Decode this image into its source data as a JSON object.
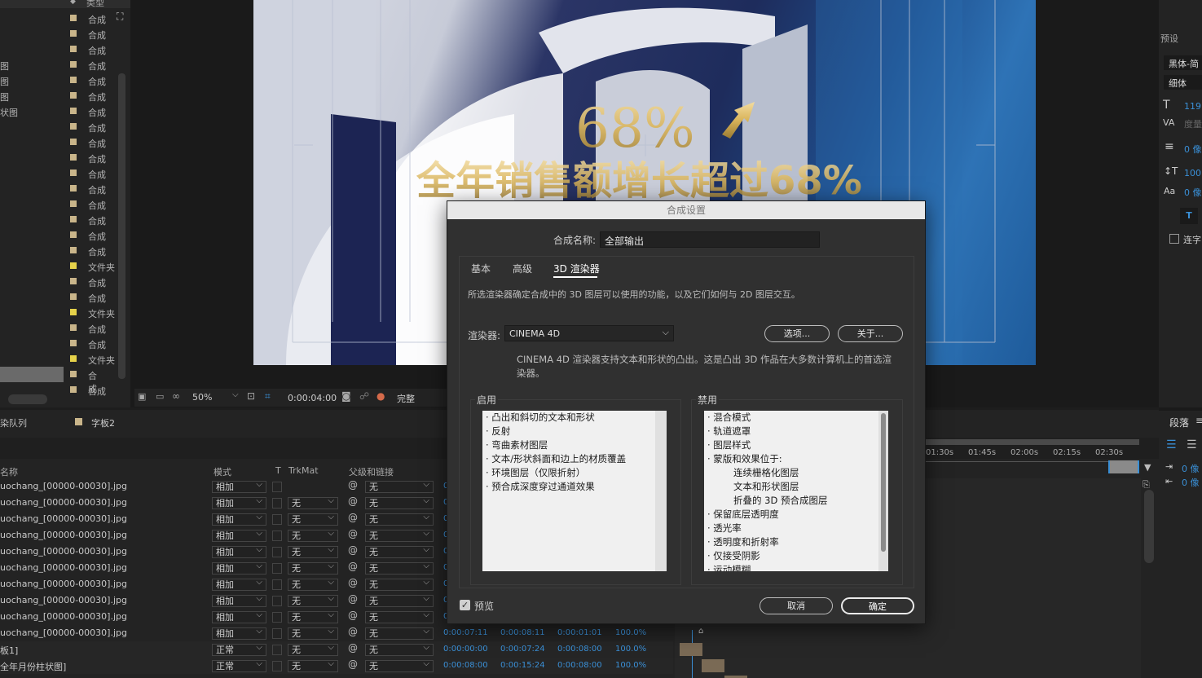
{
  "project_panel": {
    "type_header": "类型",
    "rows": [
      {
        "name": "",
        "type": "合成",
        "folder": false
      },
      {
        "name": "",
        "type": "合成",
        "folder": false
      },
      {
        "name": "",
        "type": "合成",
        "folder": false
      },
      {
        "name": "图",
        "type": "合成",
        "folder": false
      },
      {
        "name": "图",
        "type": "合成",
        "folder": false
      },
      {
        "name": "图",
        "type": "合成",
        "folder": false
      },
      {
        "name": "状图",
        "type": "合成",
        "folder": false
      },
      {
        "name": "",
        "type": "合成",
        "folder": false
      },
      {
        "name": "",
        "type": "合成",
        "folder": false
      },
      {
        "name": "",
        "type": "合成",
        "folder": false
      },
      {
        "name": "",
        "type": "合成",
        "folder": false
      },
      {
        "name": "",
        "type": "合成",
        "folder": false
      },
      {
        "name": "",
        "type": "合成",
        "folder": false
      },
      {
        "name": "",
        "type": "合成",
        "folder": false
      },
      {
        "name": "",
        "type": "合成",
        "folder": false
      },
      {
        "name": "",
        "type": "合成",
        "folder": false
      },
      {
        "name": "",
        "type": "文件夹",
        "folder": true
      },
      {
        "name": "",
        "type": "合成",
        "folder": false
      },
      {
        "name": "",
        "type": "合成",
        "folder": false
      },
      {
        "name": "",
        "type": "文件夹",
        "folder": true
      },
      {
        "name": "",
        "type": "合成",
        "folder": false
      },
      {
        "name": "",
        "type": "合成",
        "folder": false
      },
      {
        "name": "",
        "type": "文件夹",
        "folder": true
      },
      {
        "name": "",
        "type": "合成",
        "folder": false
      },
      {
        "name": "",
        "type": "合成",
        "folder": false
      }
    ]
  },
  "viewer": {
    "headline_percent": "68%",
    "headline_text": "全年销售额增长超过68%",
    "zoom": "50%",
    "timecode": "0:00:04:00",
    "resolution": "完整"
  },
  "right_panel": {
    "section_presets": "预设",
    "font_family": "黑体-简",
    "font_style": "细体",
    "font_size": "119",
    "tracking_label": "度量",
    "leading": "0 像",
    "vscale": "100",
    "baseline": "0 像",
    "ligature": "连字",
    "section_paragraph": "段落",
    "indent1": "0 像",
    "indent2": "0 像"
  },
  "timeline": {
    "tab_render_queue": "染队列",
    "tab_comp": "字板2",
    "col_name": "名称",
    "col_mode": "模式",
    "col_t": "T",
    "col_trkmat": "TrkMat",
    "col_parent": "父级和链接",
    "ruler": [
      "01:30s",
      "01:45s",
      "02:00s",
      "02:15s",
      "02:30s"
    ],
    "rows": [
      {
        "name": "uochang_[00000-00030].jpg",
        "mode": "相加",
        "trkmat": "",
        "parent": "无",
        "tc": [
          "",
          "",
          "",
          ""
        ]
      },
      {
        "name": "uochang_[00000-00030].jpg",
        "mode": "相加",
        "trkmat": "无",
        "parent": "无",
        "tc": [
          "",
          "",
          "",
          ""
        ]
      },
      {
        "name": "uochang_[00000-00030].jpg",
        "mode": "相加",
        "trkmat": "无",
        "parent": "无",
        "tc": [
          "",
          "",
          "",
          ""
        ]
      },
      {
        "name": "uochang_[00000-00030].jpg",
        "mode": "相加",
        "trkmat": "无",
        "parent": "无",
        "tc": [
          "",
          "",
          "",
          ""
        ]
      },
      {
        "name": "uochang_[00000-00030].jpg",
        "mode": "相加",
        "trkmat": "无",
        "parent": "无",
        "tc": [
          "",
          "",
          "",
          ""
        ]
      },
      {
        "name": "uochang_[00000-00030].jpg",
        "mode": "相加",
        "trkmat": "无",
        "parent": "无",
        "tc": [
          "",
          "",
          "",
          ""
        ]
      },
      {
        "name": "uochang_[00000-00030].jpg",
        "mode": "相加",
        "trkmat": "无",
        "parent": "无",
        "tc": [
          "",
          "",
          "",
          ""
        ]
      },
      {
        "name": "uochang_[00000-00030].jpg",
        "mode": "相加",
        "trkmat": "无",
        "parent": "无",
        "tc": [
          "",
          "",
          "",
          ""
        ]
      },
      {
        "name": "uochang_[00000-00030].jpg",
        "mode": "相加",
        "trkmat": "无",
        "parent": "无",
        "tc": [
          "",
          "",
          "",
          ""
        ]
      },
      {
        "name": "uochang_[00000-00030].jpg",
        "mode": "相加",
        "trkmat": "无",
        "parent": "无",
        "tc": [
          "0:00:07:11",
          "0:00:08:11",
          "0:00:01:01",
          "100.0%"
        ]
      },
      {
        "name": "板1]",
        "mode": "正常",
        "trkmat": "无",
        "parent": "无",
        "tc": [
          "0:00:00:00",
          "0:00:07:24",
          "0:00:08:00",
          "100.0%"
        ]
      },
      {
        "name": "全年月份柱状图]",
        "mode": "正常",
        "trkmat": "无",
        "parent": "无",
        "tc": [
          "0:00:08:00",
          "0:00:15:24",
          "0:00:08:00",
          "100.0%"
        ]
      }
    ]
  },
  "dialog": {
    "title": "合成设置",
    "name_label": "合成名称:",
    "name_value": "全部输出",
    "tabs": [
      "基本",
      "高级",
      "3D 渲染器"
    ],
    "active_tab": 2,
    "description": "所选渲染器确定合成中的 3D 图层可以使用的功能，以及它们如何与 2D 图层交互。",
    "renderer_label": "渲染器:",
    "renderer_value": "CINEMA 4D",
    "options_button": "选项...",
    "about_button": "关于...",
    "renderer_info_line1": "CINEMA 4D 渲染器支持文本和形状的凸出。这是凸出 3D 作品在大多数计算机上的首选渲",
    "renderer_info_line2": "染器。",
    "enabled_title": "启用",
    "enabled_items": [
      "· 凸出和斜切的文本和形状",
      "· 反射",
      "· 弯曲素材图层",
      "· 文本/形状斜面和边上的材质覆盖",
      "· 环境图层（仅限折射）",
      "· 预合成深度穿过通道效果"
    ],
    "disabled_title": "禁用",
    "disabled_items": [
      {
        "text": "· 混合模式",
        "indent": false
      },
      {
        "text": "· 轨道遮罩",
        "indent": false
      },
      {
        "text": "· 图层样式",
        "indent": false
      },
      {
        "text": "· 蒙版和效果位于:",
        "indent": false
      },
      {
        "text": "连续栅格化图层",
        "indent": true
      },
      {
        "text": "文本和形状图层",
        "indent": true
      },
      {
        "text": "折叠的 3D 预合成图层",
        "indent": true
      },
      {
        "text": "· 保留底层透明度",
        "indent": false
      },
      {
        "text": "· 透光率",
        "indent": false
      },
      {
        "text": "· 透明度和折射率",
        "indent": false
      },
      {
        "text": "· 仅接受阴影",
        "indent": false
      },
      {
        "text": "· 运动模糊",
        "indent": false
      }
    ],
    "preview_label": "预览",
    "preview_checked": true,
    "cancel_button": "取消",
    "ok_button": "确定"
  },
  "colors": {
    "accent_blue": "#3a8fd6",
    "comp_label": "#c9b58a",
    "folder_label": "#e6d24a",
    "headline_gold": "#d9b45a"
  }
}
